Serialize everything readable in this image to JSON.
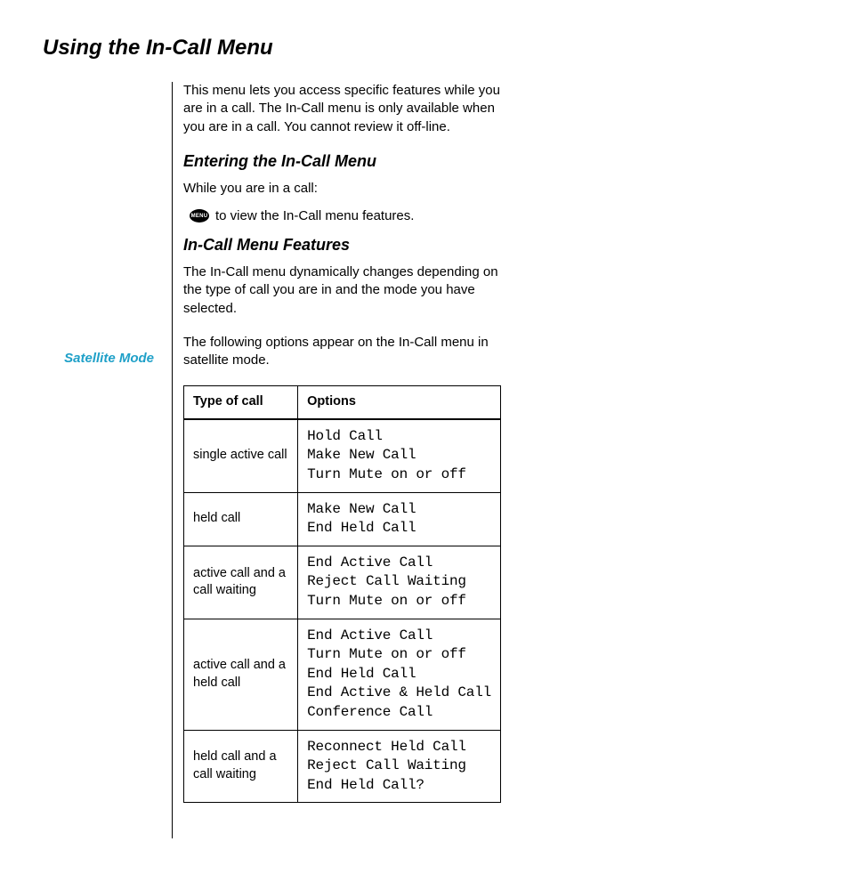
{
  "title": "Using the In-Call Menu",
  "intro": "This menu lets you access specific features while you are in a call. The In-Call menu is only available when you are in a call. You cannot review it off-line.",
  "sections": {
    "entering": {
      "heading": "Entering the In-Call Menu",
      "lead": "While you are in a call:",
      "icon_label": "MENU",
      "icon_name": "menu-icon",
      "icon_text": "to view the In-Call menu features."
    },
    "features": {
      "heading": "In-Call Menu Features",
      "para": "The In-Call menu dynamically changes depending on the type of call you are in and the mode you have selected.",
      "margin_label": "Satellite Mode",
      "mode_intro": "The following options appear on the In-Call menu in satellite mode."
    }
  },
  "table": {
    "headers": [
      "Type of call",
      "Options"
    ],
    "rows": [
      {
        "type": "single active call",
        "options": [
          "Hold Call",
          "Make New Call",
          "Turn Mute on or off"
        ]
      },
      {
        "type": "held call",
        "options": [
          "Make New Call",
          "End Held Call"
        ]
      },
      {
        "type": "active call and a call waiting",
        "options": [
          "End Active Call",
          "Reject Call Waiting",
          "Turn Mute on or off"
        ]
      },
      {
        "type": "active call and a held call",
        "options": [
          "End Active Call",
          "Turn Mute on or off",
          "End Held Call",
          "End Active & Held Call",
          "Conference Call"
        ]
      },
      {
        "type": "held call and a call waiting",
        "options": [
          "Reconnect Held Call",
          "Reject Call Waiting",
          "End Held Call?"
        ]
      }
    ]
  }
}
